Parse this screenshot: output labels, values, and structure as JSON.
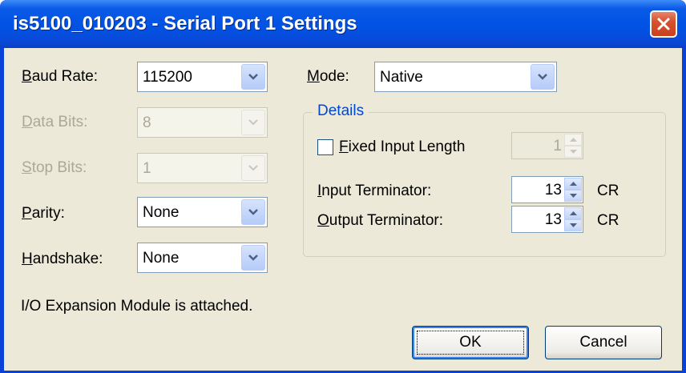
{
  "window": {
    "title": "is5100_010203 - Serial Port 1 Settings"
  },
  "left": {
    "baud_rate": {
      "label_u": "B",
      "label_rest": "aud Rate:",
      "value": "115200"
    },
    "data_bits": {
      "label_u": "D",
      "label_rest": "ata Bits:",
      "value": "8"
    },
    "stop_bits": {
      "label_u": "S",
      "label_rest": "top Bits:",
      "value": "1"
    },
    "parity": {
      "label_u": "P",
      "label_rest": "arity:",
      "value": "None"
    },
    "handshake": {
      "label_u": "H",
      "label_rest": "andshake:",
      "value": "None"
    }
  },
  "mode": {
    "label_u": "M",
    "label_rest": "ode:",
    "value": "Native"
  },
  "details": {
    "title": "Details",
    "fixed_input_length": {
      "label_u": "F",
      "label_rest": "ixed Input Length",
      "checked": false,
      "value": "1"
    },
    "input_terminator": {
      "label_u": "I",
      "label_rest": "nput Terminator:",
      "value": "13",
      "suffix": "CR"
    },
    "output_terminator": {
      "label_u": "O",
      "label_rest": "utput Terminator:",
      "value": "13",
      "suffix": "CR"
    }
  },
  "status": "I/O Expansion Module is attached.",
  "buttons": {
    "ok": "OK",
    "cancel": "Cancel"
  }
}
